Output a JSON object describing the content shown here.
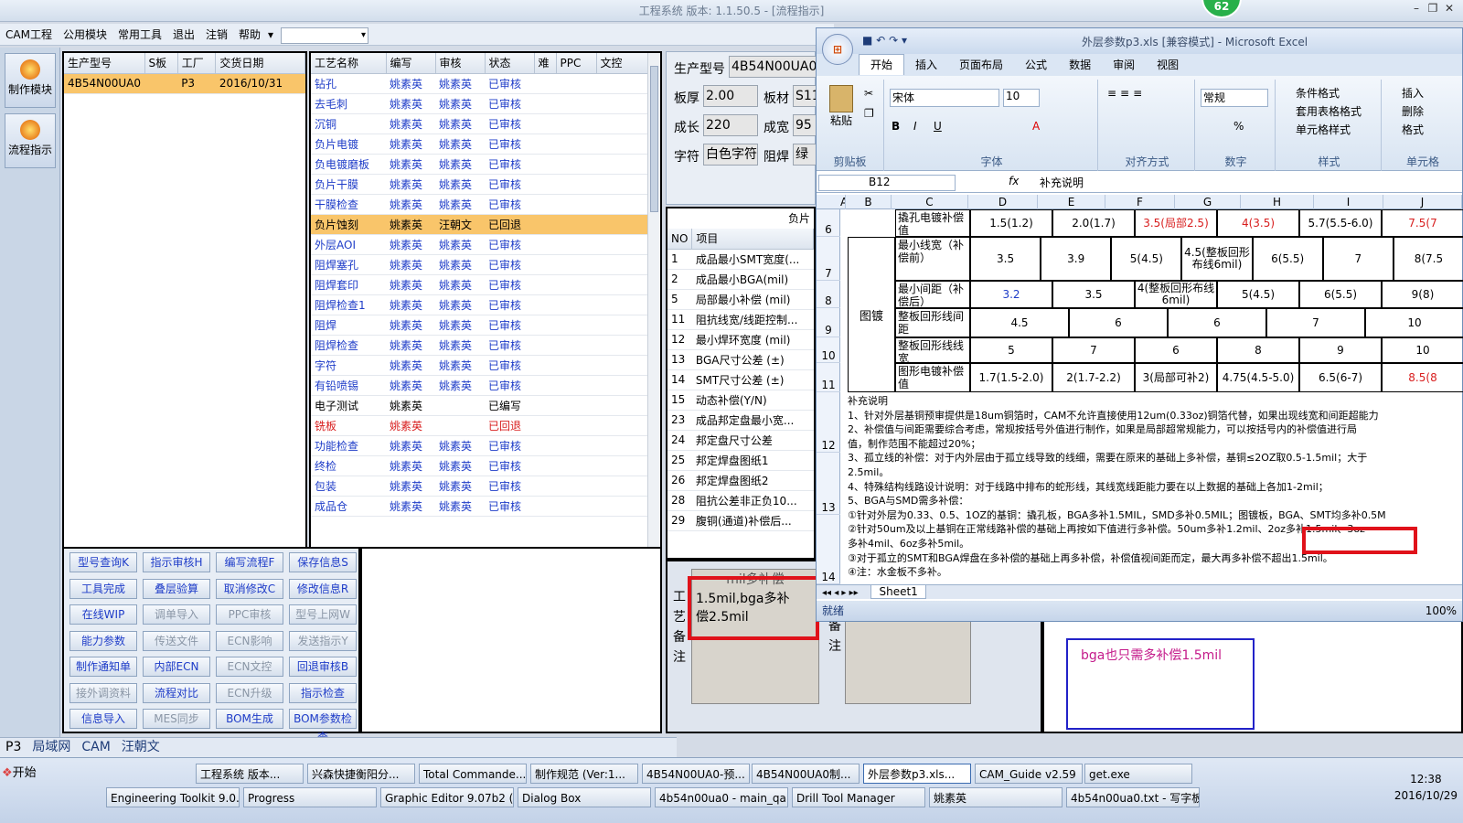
{
  "app": {
    "title": "工程系统  版本: 1.1.50.5 - [流程指示]",
    "badge": "62"
  },
  "menu": {
    "items": [
      "CAM工程",
      "公用模块",
      "常用工具",
      "退出",
      "注销",
      "帮助"
    ]
  },
  "rail": {
    "items": [
      "制作模块",
      "流程指示"
    ]
  },
  "orders": {
    "headers": [
      "生产型号",
      "S板",
      "工厂",
      "交货日期"
    ],
    "rows": [
      [
        "4B54N00UA0",
        "",
        "P3",
        "2016/10/31"
      ]
    ]
  },
  "process": {
    "headers": [
      "工艺名称",
      "编写",
      "审核",
      "状态",
      "难",
      "PPC",
      "文控"
    ],
    "rows": [
      {
        "name": "钻孔",
        "writer": "姚素英",
        "reviewer": "姚素英",
        "status": "已审核",
        "color": "blue"
      },
      {
        "name": "去毛刺",
        "writer": "姚素英",
        "reviewer": "姚素英",
        "status": "已审核",
        "color": "blue"
      },
      {
        "name": "沉铜",
        "writer": "姚素英",
        "reviewer": "姚素英",
        "status": "已审核",
        "color": "blue"
      },
      {
        "name": "负片电镀",
        "writer": "姚素英",
        "reviewer": "姚素英",
        "status": "已审核",
        "color": "blue"
      },
      {
        "name": "负电镀磨板",
        "writer": "姚素英",
        "reviewer": "姚素英",
        "status": "已审核",
        "color": "blue"
      },
      {
        "name": "负片干膜",
        "writer": "姚素英",
        "reviewer": "姚素英",
        "status": "已审核",
        "color": "blue"
      },
      {
        "name": "干膜检查",
        "writer": "姚素英",
        "reviewer": "姚素英",
        "status": "已审核",
        "color": "blue"
      },
      {
        "name": "负片蚀刻",
        "writer": "姚素英",
        "reviewer": "汪朝文",
        "status": "已回退",
        "color": "sel"
      },
      {
        "name": "外层AOI",
        "writer": "姚素英",
        "reviewer": "姚素英",
        "status": "已审核",
        "color": "blue"
      },
      {
        "name": "阻焊塞孔",
        "writer": "姚素英",
        "reviewer": "姚素英",
        "status": "已审核",
        "color": "blue"
      },
      {
        "name": "阻焊套印",
        "writer": "姚素英",
        "reviewer": "姚素英",
        "status": "已审核",
        "color": "blue"
      },
      {
        "name": "阻焊检查1",
        "writer": "姚素英",
        "reviewer": "姚素英",
        "status": "已审核",
        "color": "blue"
      },
      {
        "name": "阻焊",
        "writer": "姚素英",
        "reviewer": "姚素英",
        "status": "已审核",
        "color": "blue"
      },
      {
        "name": "阻焊检查",
        "writer": "姚素英",
        "reviewer": "姚素英",
        "status": "已审核",
        "color": "blue"
      },
      {
        "name": "字符",
        "writer": "姚素英",
        "reviewer": "姚素英",
        "status": "已审核",
        "color": "blue"
      },
      {
        "name": "有铅喷锡",
        "writer": "姚素英",
        "reviewer": "姚素英",
        "status": "已审核",
        "color": "blue"
      },
      {
        "name": "电子测试",
        "writer": "姚素英",
        "reviewer": "",
        "status": "已编写",
        "color": "black"
      },
      {
        "name": "铣板",
        "writer": "姚素英",
        "reviewer": "",
        "status": "已回退",
        "color": "red"
      },
      {
        "name": "功能检查",
        "writer": "姚素英",
        "reviewer": "姚素英",
        "status": "已审核",
        "color": "blue"
      },
      {
        "name": "终检",
        "writer": "姚素英",
        "reviewer": "姚素英",
        "status": "已审核",
        "color": "blue"
      },
      {
        "name": "包装",
        "writer": "姚素英",
        "reviewer": "姚素英",
        "status": "已审核",
        "color": "blue"
      },
      {
        "name": "成品仓",
        "writer": "姚素英",
        "reviewer": "姚素英",
        "status": "已审核",
        "color": "blue"
      }
    ]
  },
  "buttons": [
    {
      "label": "型号查询K",
      "enabled": true
    },
    {
      "label": "指示审核H",
      "enabled": true
    },
    {
      "label": "编写流程F",
      "enabled": true
    },
    {
      "label": "保存信息S",
      "enabled": true
    },
    {
      "label": "工具完成",
      "enabled": true
    },
    {
      "label": "叠层验算",
      "enabled": true
    },
    {
      "label": "取消修改C",
      "enabled": true
    },
    {
      "label": "修改信息R",
      "enabled": true
    },
    {
      "label": "在线WIP",
      "enabled": true
    },
    {
      "label": "调单导入",
      "enabled": false
    },
    {
      "label": "PPC审核",
      "enabled": false
    },
    {
      "label": "型号上网W",
      "enabled": false
    },
    {
      "label": "能力参数",
      "enabled": true
    },
    {
      "label": "传送文件",
      "enabled": false
    },
    {
      "label": "ECN影响",
      "enabled": false
    },
    {
      "label": "发送指示Y",
      "enabled": false
    },
    {
      "label": "制作通知单",
      "enabled": true
    },
    {
      "label": "内部ECN",
      "enabled": true
    },
    {
      "label": "ECN文控",
      "enabled": false
    },
    {
      "label": "回退审核B",
      "enabled": true
    },
    {
      "label": "接外调资料",
      "enabled": false
    },
    {
      "label": "流程对比",
      "enabled": true
    },
    {
      "label": "ECN升级",
      "enabled": false
    },
    {
      "label": "指示检查",
      "enabled": true
    },
    {
      "label": "信息导入",
      "enabled": true
    },
    {
      "label": "MES同步",
      "enabled": false
    },
    {
      "label": "BOM生成",
      "enabled": true
    },
    {
      "label": "BOM参数检查",
      "enabled": true
    }
  ],
  "info": {
    "model_label": "生产型号",
    "model_value": "4B54N00UA0",
    "thick_label": "板厚",
    "thick_value": "2.00",
    "material_label": "板材",
    "material_value": "S11",
    "length_label": "成长",
    "length_value": "220",
    "width_label": "成宽",
    "width_value": "95",
    "char_label": "字符",
    "char_value": "白色字符",
    "mask_label": "阻焊",
    "mask_value": "绿色"
  },
  "items": {
    "caption": "负片",
    "headers": [
      "NO",
      "项目"
    ],
    "rows": [
      [
        "1",
        "成品最小SMT宽度(..."
      ],
      [
        "2",
        "成品最小BGA(mil)"
      ],
      [
        "5",
        "局部最小补偿 (mil)"
      ],
      [
        "11",
        "阻抗线宽/线距控制..."
      ],
      [
        "12",
        "最小焊环宽度 (mil)"
      ],
      [
        "13",
        "BGA尺寸公差 (±)"
      ],
      [
        "14",
        "SMT尺寸公差 (±)"
      ],
      [
        "15",
        "动态补偿(Y/N)"
      ],
      [
        "23",
        "成品邦定盘最小宽..."
      ],
      [
        "24",
        "邦定盘尺寸公差"
      ],
      [
        "25",
        "邦定焊盘图纸1"
      ],
      [
        "26",
        "邦定焊盘图纸2"
      ],
      [
        "28",
        "阻抗公差非正负10..."
      ],
      [
        "29",
        "腹铜(通道)补偿后..."
      ]
    ]
  },
  "remarks": {
    "left_label": "工艺备注",
    "left_text": "1.5mil,bga多补偿2.5mil",
    "left_header": "mil多补偿",
    "right_label": "备注",
    "note_text": "bga也只需多补偿1.5mil"
  },
  "status_tabs": [
    "P3",
    "局域网",
    "CAM",
    "汪朝文"
  ],
  "excel": {
    "title": "外层参数p3.xls [兼容模式] - Microsoft Excel",
    "tabs": [
      "开始",
      "插入",
      "页面布局",
      "公式",
      "数据",
      "审阅",
      "视图"
    ],
    "font_name": "宋体",
    "font_size": "10",
    "number_format": "常规",
    "groups": [
      "剪贴板",
      "字体",
      "对齐方式",
      "数字",
      "样式",
      "单元格"
    ],
    "paste_label": "粘贴",
    "styles": [
      "条件格式",
      "套用表格格式",
      "单元格样式"
    ],
    "cells_cmds": [
      "插入",
      "删除",
      "格式"
    ],
    "namebox": "B12",
    "formula": "补充说明",
    "col_headers": [
      "A",
      "B",
      "C",
      "D",
      "E",
      "F",
      "G",
      "H",
      "I",
      "J"
    ],
    "row_numbers": [
      "6",
      "7",
      "8",
      "9",
      "10",
      "11",
      "12",
      "13",
      "14"
    ],
    "group_label": "图镀",
    "rows": [
      {
        "label": "撬孔电镀补偿值",
        "cells": [
          "1.5(1.2)",
          "2.0(1.7)",
          "3.5(局部2.5)",
          "4(3.5)",
          "5.7(5.5-6.0)",
          "7.5(7"
        ]
      },
      {
        "label": "最小线宽（补偿前）",
        "cells": [
          "3.5",
          "3.9",
          "5(4.5)",
          "4.5(整板回形布线6mil)",
          "6(5.5)",
          "7",
          "8(7.5"
        ]
      },
      {
        "label": "最小间距（补偿后）",
        "cells": [
          "3.2",
          "3.5",
          "4(整板回形布线6mil)",
          "5(4.5)",
          "6(5.5)",
          "9(8)"
        ]
      },
      {
        "label": "整板回形线间距",
        "cells": [
          "4.5",
          "6",
          "6",
          "7",
          "10"
        ]
      },
      {
        "label": "整板回形线线宽",
        "cells": [
          "5",
          "7",
          "6",
          "8",
          "9",
          "10"
        ]
      },
      {
        "label": "图形电镀补偿值",
        "cells": [
          "1.7(1.5-2.0)",
          "2(1.7-2.2)",
          "3(局部可补2)",
          "4.75(4.5-5.0)",
          "6.5(6-7)",
          "8.5(8"
        ]
      }
    ],
    "notes": [
      "补充说明",
      "1、针对外层基铜预审提供是18um铜箔时，CAM不允许直接使用12um(0.33oz)铜箔代替，如果出现线宽和间距超能力",
      "2、补偿值与间距需要综合考虑，常规按括号外值进行制作，如果是局部超常规能力，可以按括号内的补偿值进行局",
      "值，制作范围不能超过20%；",
      "3、孤立线的补偿：对于内外层由于孤立线导致的线细，需要在原来的基础上多补偿，基铜≤2OZ取0.5-1.5mil；大于",
      "2.5mil。",
      "4、特殊结构线路设计说明：对于线路中排布的蛇形线，其线宽线距能力要在以上数据的基础上各加1-2mil；",
      "5、BGA与SMD需多补偿：",
      "①针对外层为0.33、0.5、1OZ的基铜：撬孔板，BGA多补1.5MIL，SMD多补0.5MIL；图镀板，BGA、SMT均多补0.5M",
      "②针对50um及以上基铜在正常线路补偿的基础上再按如下值进行多补偿。50um多补1.2mil、2oz多补1.5mil、3oz",
      "多补4mil、6oz多补5mil。",
      "③对于孤立的SMT和BGA焊盘在多补偿的基础上再多补偿，补偿值视间距而定，最大再多补偿不超出1.5mil。",
      "④注：水金板不多补。"
    ],
    "highlight": "2oz多补1.5mil",
    "sheet_tab": "Sheet1",
    "status": "就绪",
    "zoom": "100%"
  },
  "taskbar": {
    "start": "开始",
    "top": [
      "工程系统  版本...",
      "兴森快捷衡阳分...",
      "Total Commande...",
      "制作规范 (Ver:1...",
      "4B54N00UA0-预...",
      "4B54N00UA0制...",
      "外层参数p3.xls...",
      "CAM_Guide v2.59",
      "get.exe"
    ],
    "bottom": [
      "Engineering Toolkit 9.0...",
      "Progress",
      "Graphic Editor 9.07b2 (...",
      "Dialog Box",
      "4b54n00ua0 - main_qa",
      "Drill Tool Manager",
      "姚素英",
      "4b54n00ua0.txt - 写字板"
    ],
    "time": "12:38",
    "date": "2016/10/29"
  }
}
